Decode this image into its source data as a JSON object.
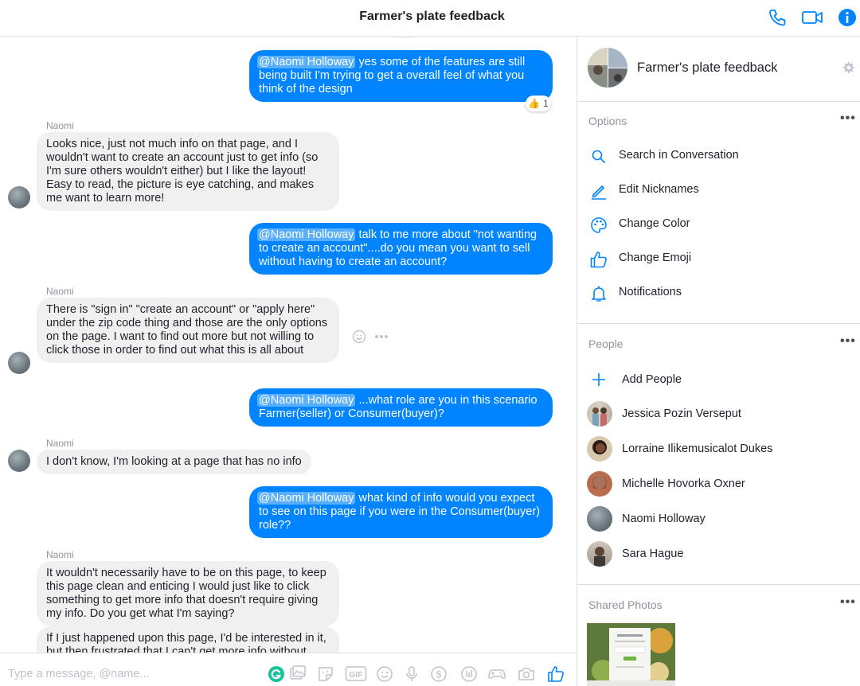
{
  "header": {
    "title": "Farmer's plate feedback",
    "accent": "#0084ff"
  },
  "messages": {
    "m1": {
      "mention": "@Naomi Holloway",
      "text": " yes some of the features are still being built I'm trying to get a overall feel of what you think of the design",
      "reaction_count": "1"
    },
    "m2": {
      "sender": "Naomi",
      "text": "Looks nice, just not much info on that page, and I wouldn't want to create an account just to get info (so I'm sure others wouldn't either) but I like the layout! Easy to read, the picture is eye catching, and makes me want to learn more!"
    },
    "m3": {
      "mention": "@Naomi Holloway",
      "text": " talk to me more about \"not wanting to create an account\"....do you mean you want to sell without having to create an account?"
    },
    "m4": {
      "sender": "Naomi",
      "text": "There is \"sign in\" \"create an account\" or \"apply here\" under the zip code thing and those are the only options on the page. I want to find out more but not willing to click those in order to find out what this is all about"
    },
    "m5": {
      "mention": "@Naomi Holloway",
      "text": " ...what role are you in this scenario Farmer(seller) or Consumer(buyer)?"
    },
    "m6": {
      "sender": "Naomi",
      "text": "I don't know, I'm looking at a page that has no info"
    },
    "m7": {
      "mention": "@Naomi Holloway",
      "text": " what kind of info would you expect to see on this page if you were in the Consumer(buyer) role??"
    },
    "m8": {
      "sender": "Naomi",
      "text": "It wouldn't necessarily have to be on this page, to keep this page clean and enticing I would just like to click something to get more info that doesn't require giving my info. Do you get what I'm saying?"
    },
    "m9": {
      "text": "If I just happened upon this page, I'd be interested in it, but then frustrated that I can't get more info without"
    }
  },
  "composer": {
    "placeholder": "Type a message, @name..."
  },
  "panel": {
    "conversation_name": "Farmer's plate feedback",
    "options_label": "Options",
    "options": [
      {
        "label": "Search in Conversation",
        "icon": "search-icon"
      },
      {
        "label": "Edit Nicknames",
        "icon": "pencil-icon"
      },
      {
        "label": "Change Color",
        "icon": "palette-icon"
      },
      {
        "label": "Change Emoji",
        "icon": "thumbs-up-icon"
      },
      {
        "label": "Notifications",
        "icon": "bell-icon"
      }
    ],
    "people_label": "People",
    "add_people": "Add People",
    "people": [
      {
        "name": "Jessica Pozin Verseput"
      },
      {
        "name": "Lorraine Ilikemusicalot Dukes"
      },
      {
        "name": "Michelle Hovorka Oxner"
      },
      {
        "name": "Naomi Holloway"
      },
      {
        "name": "Sara Hague"
      }
    ],
    "shared_photos_label": "Shared Photos"
  }
}
